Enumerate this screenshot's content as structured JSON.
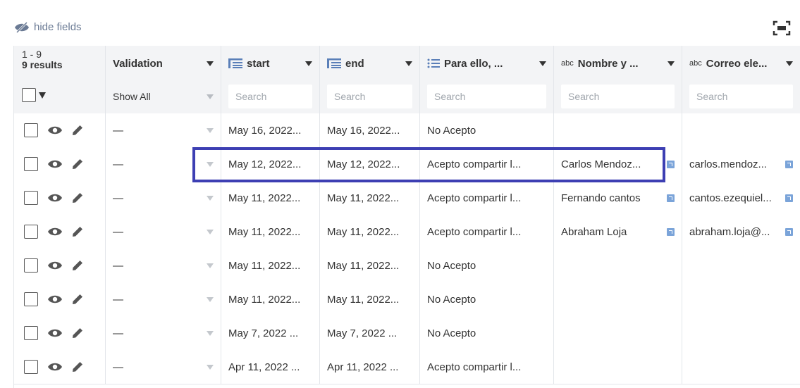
{
  "toolbar": {
    "hide_fields_label": "hide fields"
  },
  "header": {
    "range": "1 - 9",
    "results": "9 results",
    "columns": [
      {
        "label": "Validation",
        "type_icon": "none"
      },
      {
        "label": "start",
        "type_icon": "date-icon"
      },
      {
        "label": "end",
        "type_icon": "date-icon"
      },
      {
        "label": "Para ello, ...",
        "type_icon": "list-icon"
      },
      {
        "label": "Nombre y ...",
        "type_icon": "abc-icon"
      },
      {
        "label": "Correo ele...",
        "type_icon": "abc-icon"
      }
    ],
    "abc_glyph": "abc"
  },
  "filters": {
    "validation": "Show All",
    "start_placeholder": "Search",
    "end_placeholder": "Search",
    "para_placeholder": "Search",
    "nombre_placeholder": "Search",
    "correo_placeholder": "Search"
  },
  "rows": [
    {
      "validation": "—",
      "start": "May 16, 2022...",
      "end": "May 16, 2022...",
      "para": "No Acepto",
      "nombre": "",
      "correo": ""
    },
    {
      "validation": "—",
      "start": "May 12, 2022...",
      "end": "May 12, 2022...",
      "para": "Acepto compartir l...",
      "nombre": "Carlos Mendoz...",
      "correo": "carlos.mendoz..."
    },
    {
      "validation": "—",
      "start": "May 11, 2022...",
      "end": "May 11, 2022...",
      "para": "Acepto compartir l...",
      "nombre": "Fernando cantos",
      "correo": "cantos.ezequiel..."
    },
    {
      "validation": "—",
      "start": "May 11, 2022...",
      "end": "May 11, 2022...",
      "para": "Acepto compartir l...",
      "nombre": "Abraham Loja",
      "correo": "abraham.loja@..."
    },
    {
      "validation": "—",
      "start": "May 11, 2022...",
      "end": "May 11, 2022...",
      "para": "No Acepto",
      "nombre": "",
      "correo": ""
    },
    {
      "validation": "—",
      "start": "May 11, 2022...",
      "end": "May 11, 2022...",
      "para": "No Acepto",
      "nombre": "",
      "correo": ""
    },
    {
      "validation": "—",
      "start": "May 7, 2022 ...",
      "end": "May 7, 2022 ...",
      "para": "No Acepto",
      "nombre": "",
      "correo": ""
    },
    {
      "validation": "—",
      "start": "Apr 11, 2022 ...",
      "end": "Apr 11, 2022 ...",
      "para": "Acepto compartir l...",
      "nombre": "",
      "correo": ""
    }
  ],
  "colors": {
    "highlight": "#3d3fb3",
    "link_icon": "#7ba4d9",
    "header_bg": "#f3f4f6"
  }
}
